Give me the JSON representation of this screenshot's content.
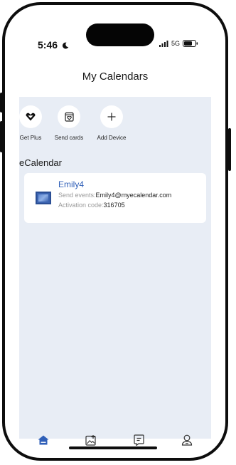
{
  "status_bar": {
    "time": "5:46",
    "network": "5G",
    "icons": [
      "moon-icon",
      "signal-icon",
      "battery-icon"
    ]
  },
  "header": {
    "title": "My Calendars"
  },
  "quick_actions": [
    {
      "label": "Get Plus",
      "icon": "heart-diamond-icon"
    },
    {
      "label": "Send cards",
      "icon": "card-icon"
    },
    {
      "label": "Add Device",
      "icon": "plus-icon"
    }
  ],
  "section": {
    "title": "eCalendar"
  },
  "device": {
    "name": "Emily4",
    "send_events_label": "Send events:",
    "send_events_value": "Emily4@myecalendar.com",
    "activation_label": "Activation code:",
    "activation_value": "316705"
  },
  "tabs": [
    {
      "icon": "home-icon",
      "active": true
    },
    {
      "icon": "photo-add-icon",
      "active": false
    },
    {
      "icon": "message-icon",
      "active": false
    },
    {
      "icon": "person-icon",
      "active": false
    }
  ],
  "colors": {
    "accent": "#2f5fb8",
    "background": "#e8edf5",
    "card": "#ffffff"
  }
}
